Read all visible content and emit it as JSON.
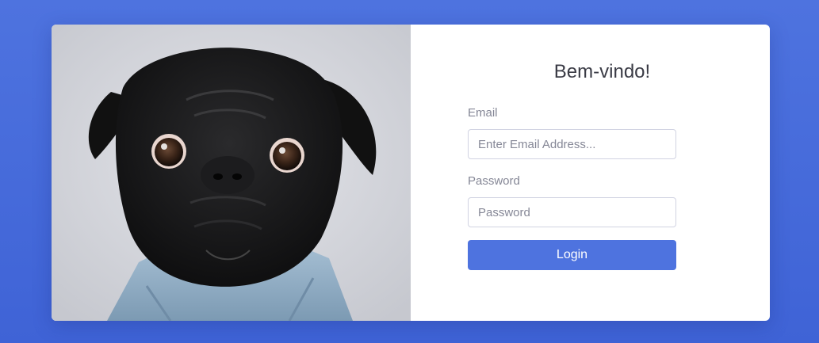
{
  "login": {
    "heading": "Bem-vindo!",
    "email_label": "Email",
    "email_placeholder": "Enter Email Address...",
    "email_value": "",
    "password_label": "Password",
    "password_placeholder": "Password",
    "password_value": "",
    "login_button_label": "Login"
  },
  "colors": {
    "background": "#4e73df",
    "card": "#ffffff",
    "primary_button": "#4e73df",
    "heading_text": "#3a3b45",
    "label_text": "#858796"
  },
  "image": {
    "subject": "black-pug-photo"
  }
}
